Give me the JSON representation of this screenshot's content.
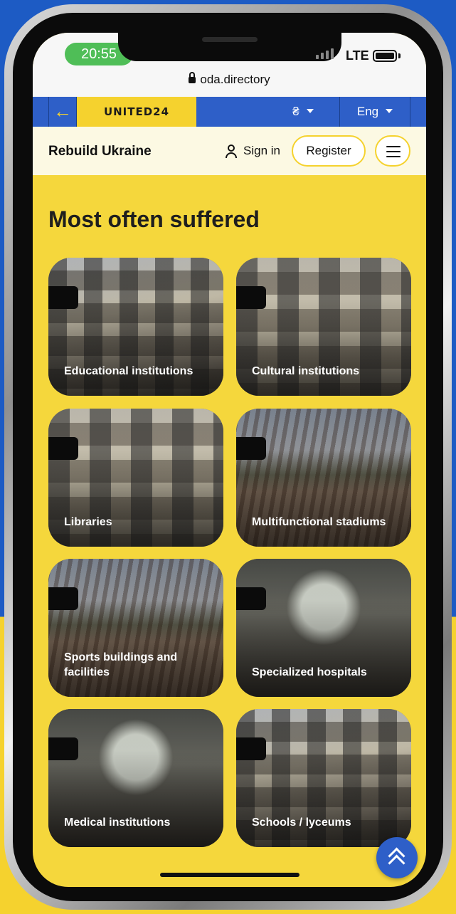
{
  "status_bar": {
    "time": "20:55",
    "network": "LTE"
  },
  "browser": {
    "url": "oda.directory"
  },
  "united24_bar": {
    "logo": "UNITED24",
    "currency": "₴",
    "language": "Eng"
  },
  "site_header": {
    "brand": "Rebuild Ukraine",
    "sign_in": "Sign in",
    "register": "Register"
  },
  "section": {
    "title": "Most often suffered",
    "cards": [
      {
        "label": "Educational institutions",
        "image": "damaged-school-building"
      },
      {
        "label": "Cultural institutions",
        "image": "damaged-building-facade"
      },
      {
        "label": "Libraries",
        "image": "damaged-building-facade"
      },
      {
        "label": "Multifunctional stadiums",
        "image": "collapsed-roof-rubble"
      },
      {
        "label": "Sports buildings and facilities",
        "image": "collapsed-roof-rubble"
      },
      {
        "label": "Specialized hospitals",
        "image": "destroyed-interior-room"
      },
      {
        "label": "Medical institutions",
        "image": "destroyed-interior-room"
      },
      {
        "label": "Schools / lyceums",
        "image": "damaged-school-building"
      }
    ]
  },
  "colors": {
    "accent_yellow": "#f5d22e",
    "brand_blue": "#2e5fc8"
  },
  "icons": {
    "back": "arrow-left-icon",
    "user": "user-icon",
    "menu": "hamburger-icon",
    "scroll_top": "double-chevron-up-icon",
    "lock": "lock-icon"
  }
}
